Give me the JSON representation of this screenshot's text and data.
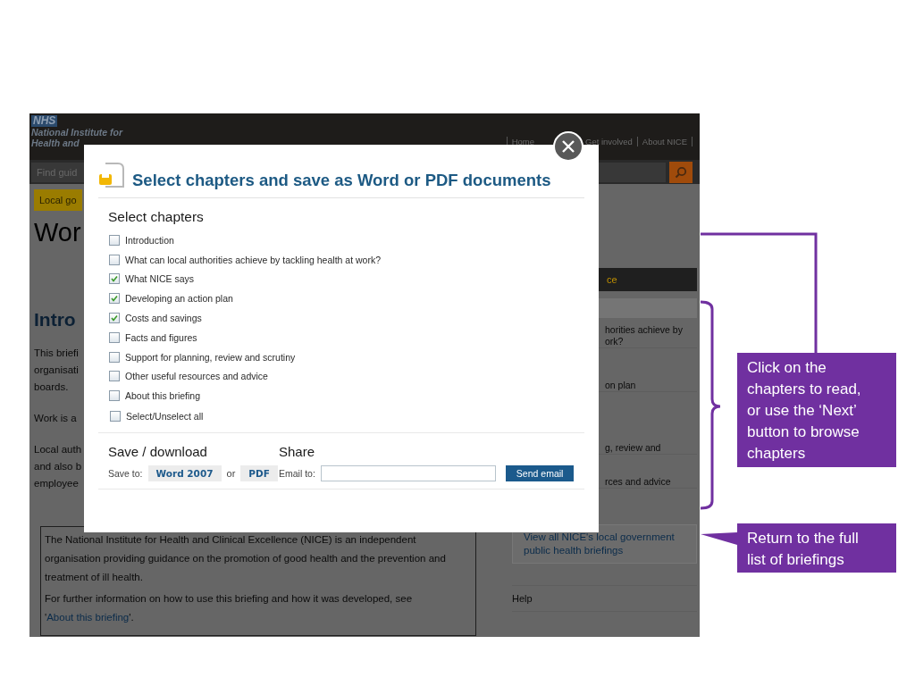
{
  "page": {
    "header": {
      "logo": "NHS",
      "org_lines": [
        "National Institute for",
        "Health and"
      ],
      "nav": [
        "Home",
        "Get involved",
        "About NICE"
      ]
    },
    "search": {
      "placeholder": "Find guid"
    },
    "tag": "Local go",
    "heading": "Wor",
    "section_heading": "Intro",
    "paragraphs": [
      [
        "This briefi",
        "organisati",
        "boards."
      ],
      [
        "Work is a"
      ],
      [
        "Local auth",
        "and also b",
        "employee"
      ]
    ],
    "about_box": {
      "text": "The National Institute for Health and Clinical Excellence (NICE) is an independent organisation providing guidance on the promotion of good health and the prevention and treatment of ill health.",
      "more": "For further information on how to use this briefing and how it was developed, see '",
      "link": "About this briefing",
      "after": "'."
    },
    "sidebar": {
      "download_bar": "ce",
      "items": [
        [
          "horities achieve by",
          "ork?"
        ],
        [
          "on plan"
        ],
        [
          "g, review and"
        ],
        [
          "rces and advice"
        ]
      ],
      "briefings_link": "View all NICE's local government public health briefings",
      "help": "Help"
    }
  },
  "modal": {
    "title": "Select chapters and save as Word or PDF documents",
    "chapters_heading": "Select chapters",
    "chapters": [
      {
        "label": "Introduction",
        "checked": false
      },
      {
        "label": "What can local authorities achieve by tackling health at work?",
        "checked": false
      },
      {
        "label": "What NICE says",
        "checked": true
      },
      {
        "label": "Developing an action plan",
        "checked": true
      },
      {
        "label": "Costs and savings",
        "checked": true
      },
      {
        "label": "Facts and figures",
        "checked": false
      },
      {
        "label": "Support for planning, review and scrutiny",
        "checked": false
      },
      {
        "label": "Other useful resources and advice",
        "checked": false
      },
      {
        "label": "About this briefing",
        "checked": false
      }
    ],
    "select_all": {
      "label": "Select/Unselect all",
      "checked": false
    },
    "save": {
      "heading": "Save / download",
      "label": "Save to:",
      "word": "Word 2007",
      "or": "or",
      "pdf": "PDF"
    },
    "share": {
      "heading": "Share",
      "label": "Email to:",
      "button": "Send email"
    }
  },
  "callouts": [
    {
      "text": "Click on the chapters to read, or use the ‘Next’ button to browse chapters"
    },
    {
      "text": "Return to the full list of briefings"
    }
  ]
}
